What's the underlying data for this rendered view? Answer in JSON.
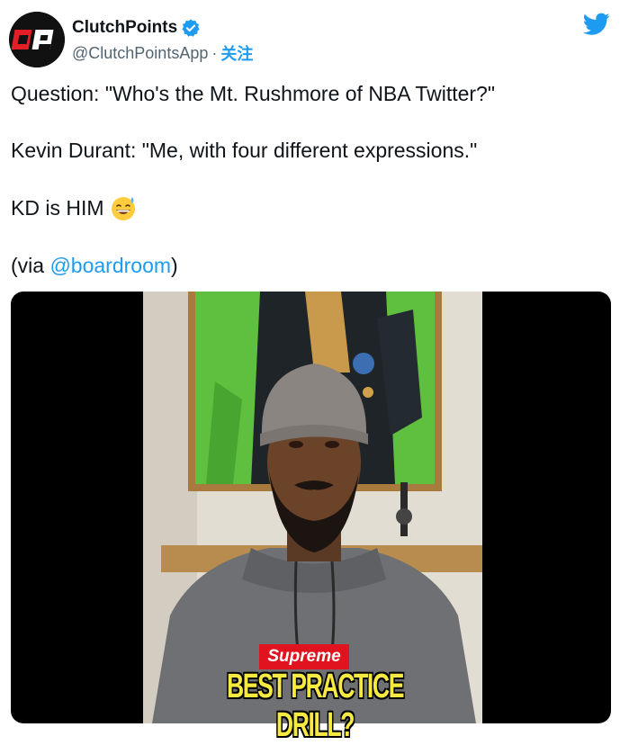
{
  "account": {
    "display_name": "ClutchPoints",
    "handle": "@ClutchPointsApp",
    "separator": "·",
    "follow_label": "关注",
    "avatar_initials": "CP"
  },
  "tweet": {
    "line1": "Question: \"Who's the Mt. Rushmore of NBA Twitter?\"",
    "line2": "Kevin Durant: \"Me, with four different expressions.\"",
    "line3": "KD is HIM",
    "line4_prefix": "(via ",
    "line4_mention": "@boardroom",
    "line4_suffix": ")"
  },
  "media": {
    "brand_label": "Supreme",
    "caption": "BEST PRACTICE DRILL?"
  },
  "colors": {
    "accent": "#1d9bf0",
    "text": "#0f1419",
    "secondary": "#536471",
    "brand_red": "#e0131e",
    "caption_yellow": "#f5e942"
  },
  "icons": {
    "verified": "verified-badge-icon",
    "twitter": "twitter-bird-icon",
    "emoji": "grinning-face-with-sweat-emoji"
  }
}
